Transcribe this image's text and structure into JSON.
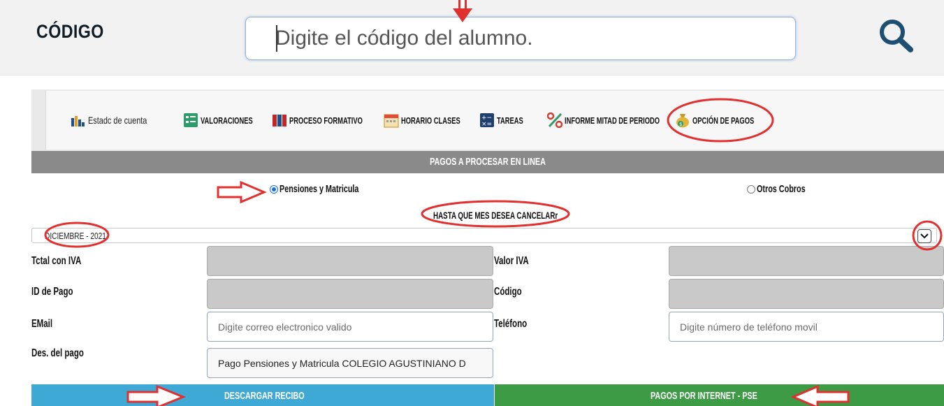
{
  "topbar": {
    "code_label": "CÓDIGO",
    "search_placeholder": "Digite el código del alumno."
  },
  "nav": {
    "items": [
      {
        "label": "Estadc de cuenta",
        "icon": "bar-chart-icon"
      },
      {
        "label": "VALORACIONES",
        "icon": "checklist-icon"
      },
      {
        "label": "PROCESO FORMATIVO",
        "icon": "books-icon"
      },
      {
        "label": "HORARIO CLASES",
        "icon": "calendar-icon"
      },
      {
        "label": "TAREAS",
        "icon": "calculator-icon"
      },
      {
        "label": "INFORME MITAD DE PERIODO",
        "icon": "percent-icon"
      },
      {
        "label": "OPCIÓN DE PAGOS",
        "icon": "money-bag-icon"
      }
    ]
  },
  "payments": {
    "header": "PAGOS A PROCESAR EN LINEA",
    "radio_pensiones": "Pensiones y Matricula",
    "radio_otros": "Otros Cobros",
    "month_question": "HASTA QUE MES DESEA CANCELARr",
    "month_selected": "DICIEMBRE - 2021"
  },
  "form": {
    "total_iva_label": "Tctal con IVA",
    "valor_iva_label": "Valor IVA",
    "id_pago_label": "ID de Pago",
    "codigo_label": "Código",
    "email_label": "EMail",
    "email_placeholder": "Digite correo electronico valido",
    "telefono_label": "Teléfono",
    "telefono_placeholder": "Digite número de teléfono movil",
    "descripcion_label": "Des. del pago",
    "descripcion_value": "Pago Pensiones y Matricula COLEGIO AGUSTINIANO D"
  },
  "buttons": {
    "recibo": "DESCARGAR RECIBO",
    "pse": "PAGOS POR INTERNET - PSE"
  },
  "colors": {
    "annotation_red": "#e03030",
    "recibo_blue": "#3fa9d6",
    "pse_green": "#3e9b45",
    "strip_grey": "#8a8a8a"
  }
}
